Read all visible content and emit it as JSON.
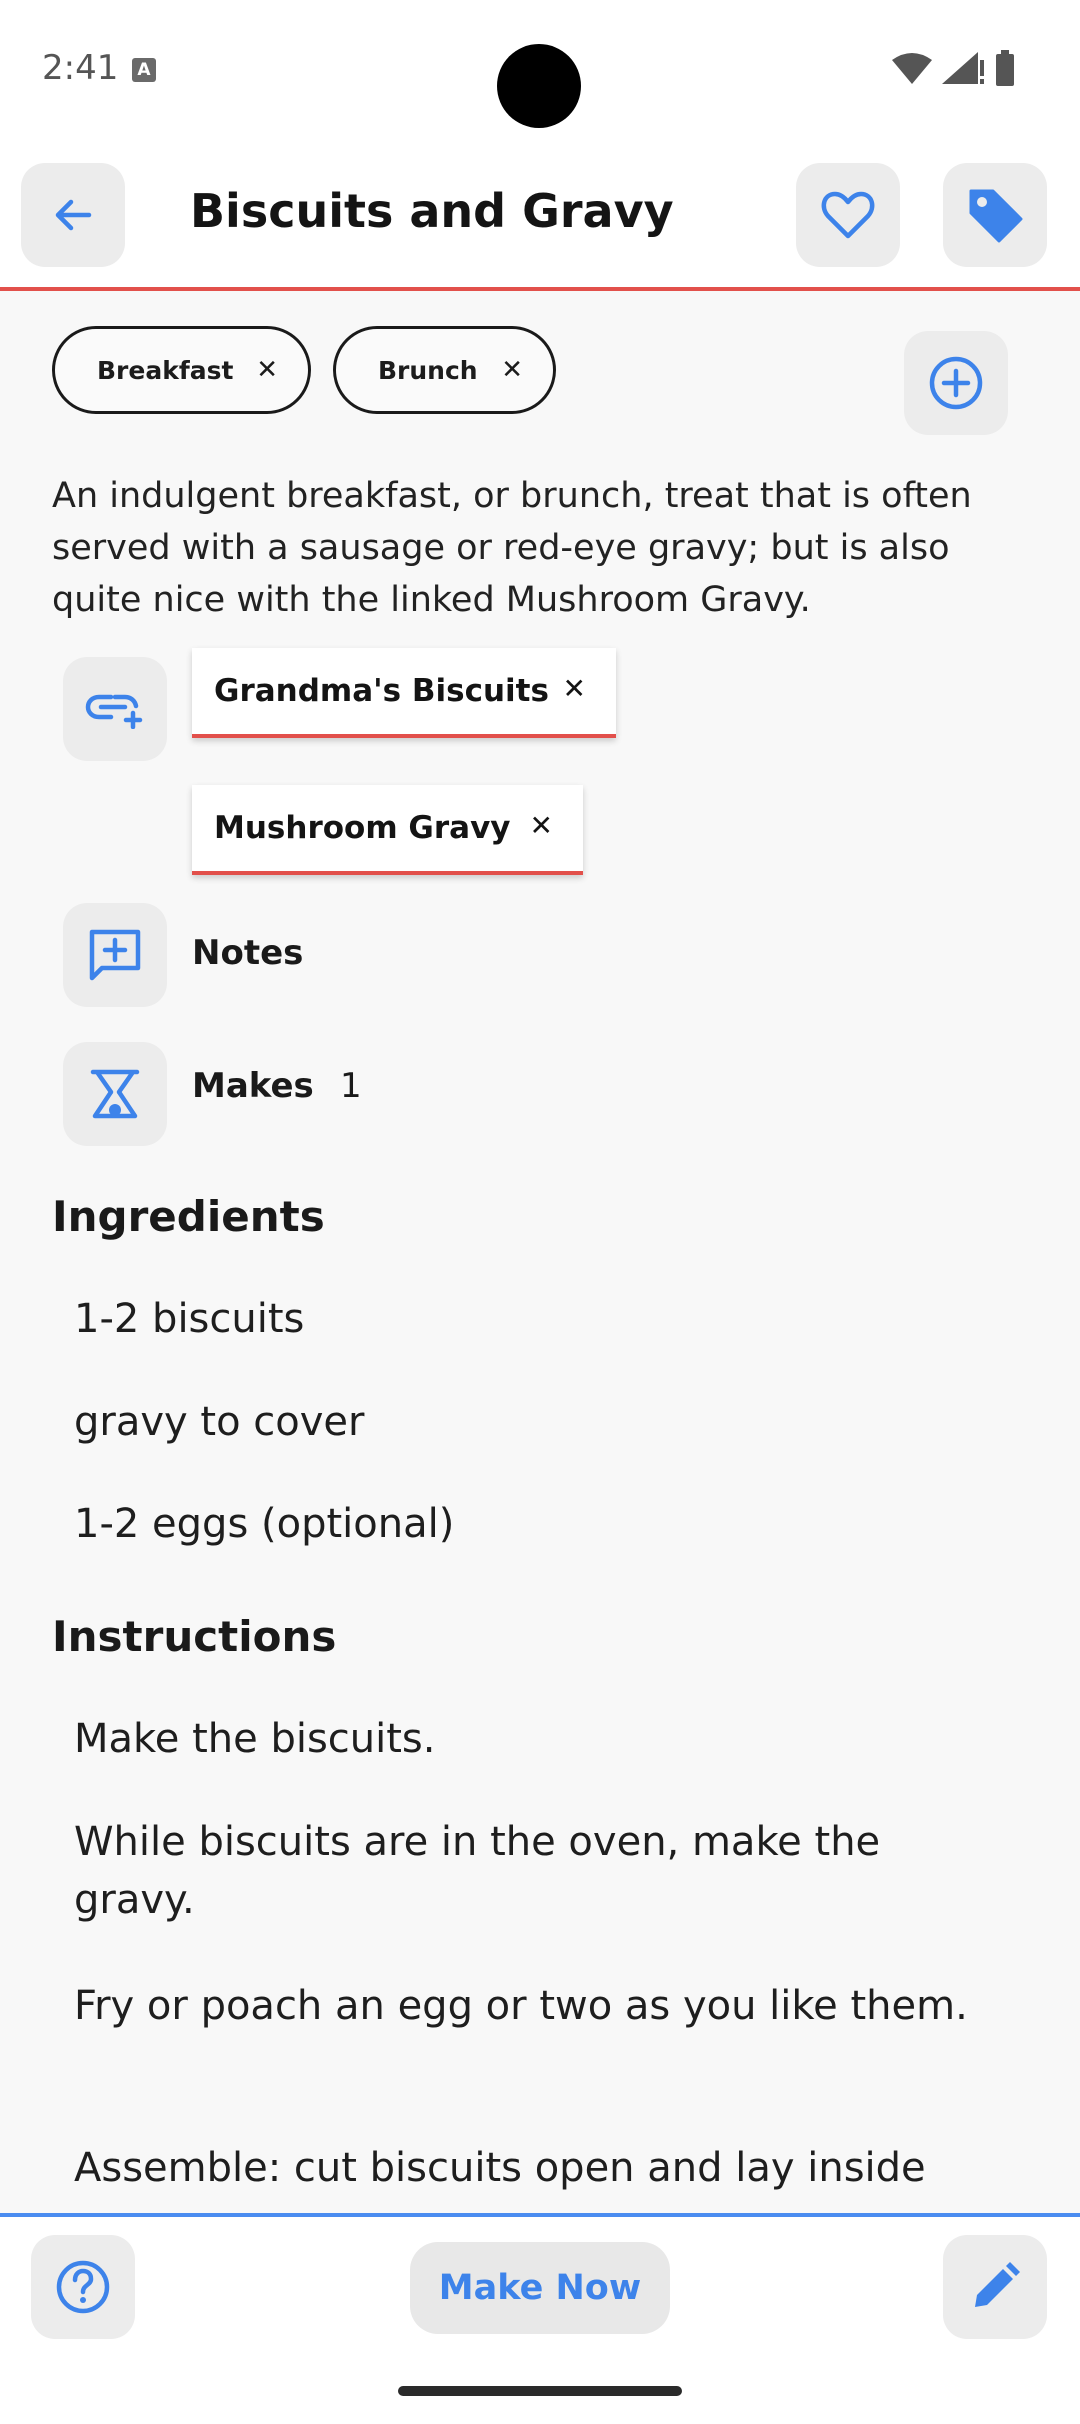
{
  "status": {
    "time": "2:41"
  },
  "header": {
    "title": "Biscuits and Gravy"
  },
  "tags": [
    {
      "label": "Breakfast"
    },
    {
      "label": "Brunch"
    }
  ],
  "description": "An indulgent breakfast, or brunch, treat that is often served with a sausage or red-eye gravy; but is also quite nice with the linked Mushroom Gravy.",
  "linked_recipes": [
    {
      "label": "Grandma's Biscuits"
    },
    {
      "label": "Mushroom Gravy"
    }
  ],
  "notes_label": "Notes",
  "makes": {
    "label": "Makes",
    "value": "1"
  },
  "ingredients": {
    "heading": "Ingredients",
    "items": [
      "1-2 biscuits",
      "gravy to cover",
      "1-2 eggs (optional)"
    ]
  },
  "instructions": {
    "heading": "Instructions",
    "items": [
      "Make the biscuits.",
      "While biscuits are in the oven, make the gravy.",
      "Fry or poach an egg or two as you like them.",
      "Assemble: cut biscuits open and lay inside"
    ]
  },
  "bottom": {
    "make_now_label": "Make Now"
  },
  "colors": {
    "accent": "#3d83ea",
    "divider": "#e2504b"
  },
  "icons": {
    "back": "arrow-left-icon",
    "favorite": "heart-outline-icon",
    "tag": "tag-icon",
    "add_tag": "add-circle-icon",
    "add_link": "add-link-icon",
    "notes": "add-comment-icon",
    "makes": "scale-icon",
    "help": "help-circle-icon",
    "edit": "pencil-icon"
  }
}
